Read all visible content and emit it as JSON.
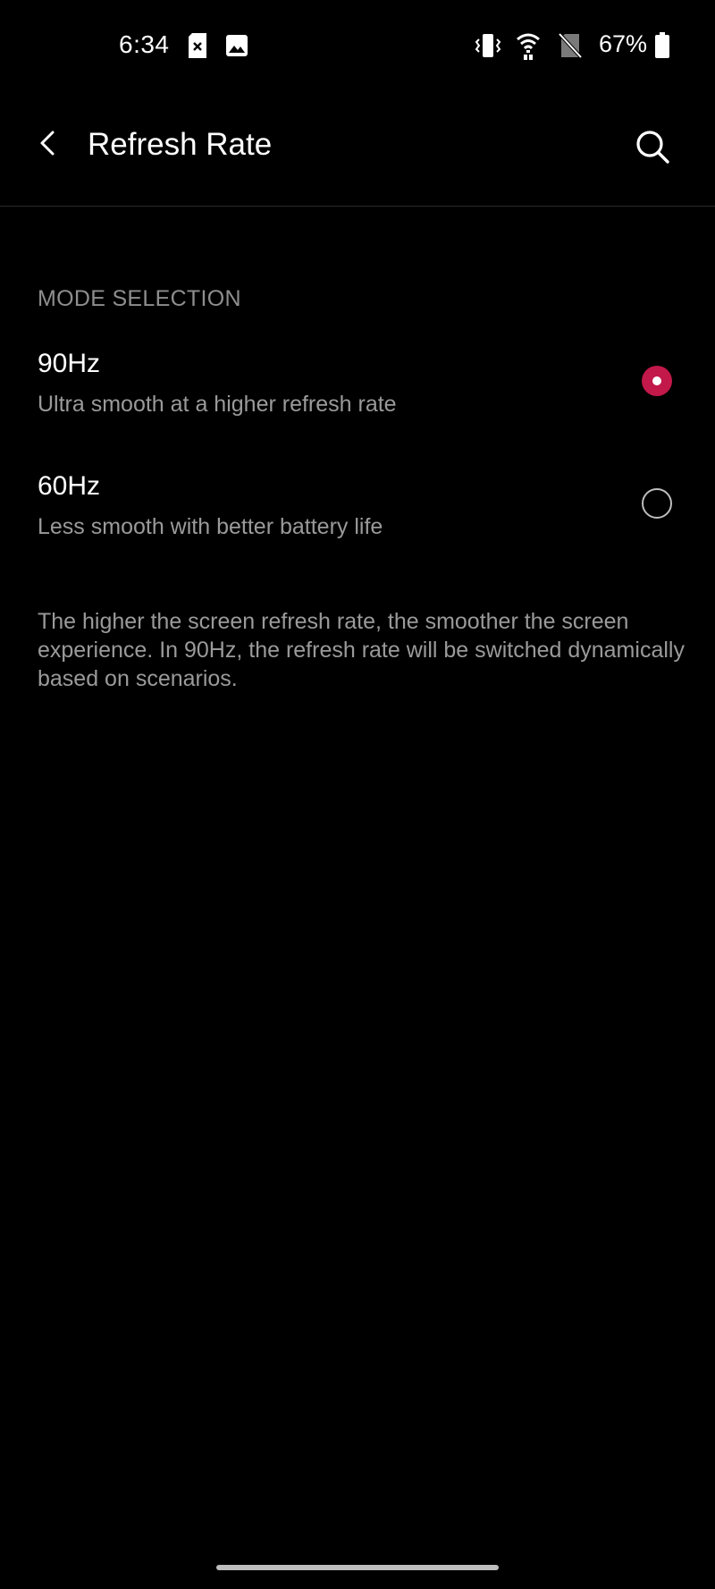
{
  "status_bar": {
    "time": "6:34",
    "battery_percent": "67%",
    "icons": [
      "sim-card-icon",
      "image-icon",
      "vibrate-icon",
      "wifi-icon",
      "no-sim-icon",
      "battery-icon"
    ]
  },
  "app_bar": {
    "title": "Refresh Rate",
    "back_icon": "back-arrow-icon",
    "search_icon": "search-icon"
  },
  "section": {
    "header": "MODE SELECTION"
  },
  "options": [
    {
      "title": "90Hz",
      "subtitle": "Ultra smooth at a higher refresh rate",
      "selected": true
    },
    {
      "title": "60Hz",
      "subtitle": "Less smooth with better battery life",
      "selected": false
    }
  ],
  "footer": {
    "description": "The higher the screen refresh rate, the smoother the screen experience. In 90Hz, the refresh rate will be switched dynamically based on scenarios."
  },
  "colors": {
    "background": "#000000",
    "accent": "#c2184a",
    "secondary_text": "#9a9a9a"
  }
}
